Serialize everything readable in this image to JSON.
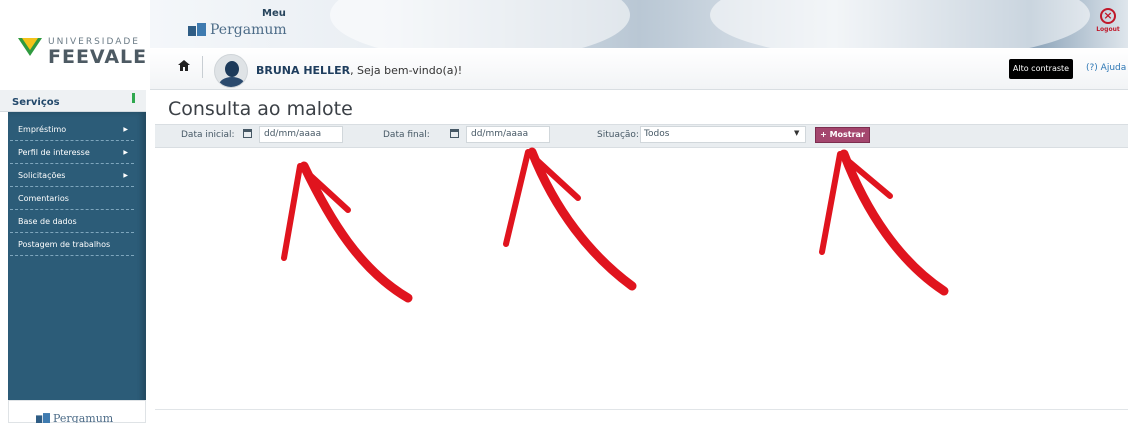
{
  "brand": {
    "university_top": "UNIVERSIDADE",
    "university_name": "FEEVALE",
    "product_meu": "Meu",
    "product_name": "Pergamum",
    "accent_color": "#a4466e",
    "sidebar_color": "#2c5c78"
  },
  "header": {
    "logout_label": "Logout",
    "user_name": "BRUNA HELLER",
    "welcome_suffix": ", Seja bem-vindo(a)!",
    "high_contrast_label": "Alto contraste",
    "help_label": "(?) Ajuda"
  },
  "sidebar": {
    "title": "Serviços",
    "items": [
      {
        "label": "Empréstimo",
        "has_submenu": true
      },
      {
        "label": "Perfil de interesse",
        "has_submenu": true
      },
      {
        "label": "Solicitações",
        "has_submenu": true
      },
      {
        "label": "Comentarios",
        "has_submenu": false
      },
      {
        "label": "Base de dados",
        "has_submenu": false
      },
      {
        "label": "Postagem de trabalhos",
        "has_submenu": false
      }
    ],
    "footer_logo": "Pergamum"
  },
  "main": {
    "title": "Consulta ao malote",
    "filters": {
      "start_label": "Data inicial:",
      "start_placeholder": "dd/mm/aaaa",
      "end_label": "Data final:",
      "end_placeholder": "dd/mm/aaaa",
      "status_label": "Situação:",
      "status_value": "Todos",
      "submit_label": "+ Mostrar"
    }
  },
  "annotations": {
    "arrow_color": "#e0141e",
    "arrow_targets": [
      "start-date-input",
      "end-date-input",
      "mostrar-button"
    ]
  }
}
